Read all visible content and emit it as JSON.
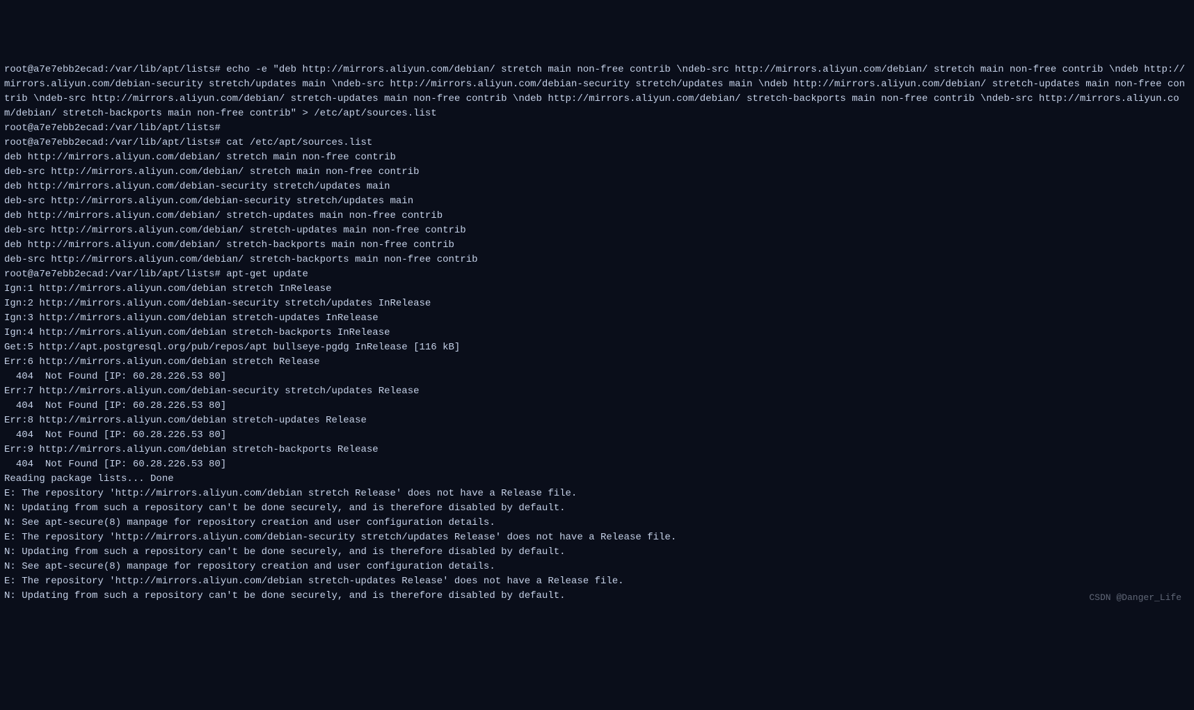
{
  "prompt": "root@a7e7ebb2ecad:/var/lib/apt/lists#",
  "lines": [
    "root@a7e7ebb2ecad:/var/lib/apt/lists# echo -e \"deb http://mirrors.aliyun.com/debian/ stretch main non-free contrib \\ndeb-src http://mirrors.aliyun.com/debian/ stretch main non-free contrib \\ndeb http://mirrors.aliyun.com/debian-security stretch/updates main \\ndeb-src http://mirrors.aliyun.com/debian-security stretch/updates main \\ndeb http://mirrors.aliyun.com/debian/ stretch-updates main non-free contrib \\ndeb-src http://mirrors.aliyun.com/debian/ stretch-updates main non-free contrib \\ndeb http://mirrors.aliyun.com/debian/ stretch-backports main non-free contrib \\ndeb-src http://mirrors.aliyun.com/debian/ stretch-backports main non-free contrib\" > /etc/apt/sources.list",
    "root@a7e7ebb2ecad:/var/lib/apt/lists#",
    "root@a7e7ebb2ecad:/var/lib/apt/lists# cat /etc/apt/sources.list",
    "deb http://mirrors.aliyun.com/debian/ stretch main non-free contrib ",
    "deb-src http://mirrors.aliyun.com/debian/ stretch main non-free contrib ",
    "deb http://mirrors.aliyun.com/debian-security stretch/updates main ",
    "deb-src http://mirrors.aliyun.com/debian-security stretch/updates main ",
    "deb http://mirrors.aliyun.com/debian/ stretch-updates main non-free contrib ",
    "deb-src http://mirrors.aliyun.com/debian/ stretch-updates main non-free contrib ",
    "deb http://mirrors.aliyun.com/debian/ stretch-backports main non-free contrib ",
    "deb-src http://mirrors.aliyun.com/debian/ stretch-backports main non-free contrib",
    "root@a7e7ebb2ecad:/var/lib/apt/lists# apt-get update",
    "Ign:1 http://mirrors.aliyun.com/debian stretch InRelease",
    "Ign:2 http://mirrors.aliyun.com/debian-security stretch/updates InRelease",
    "Ign:3 http://mirrors.aliyun.com/debian stretch-updates InRelease",
    "Ign:4 http://mirrors.aliyun.com/debian stretch-backports InRelease",
    "Get:5 http://apt.postgresql.org/pub/repos/apt bullseye-pgdg InRelease [116 kB]",
    "Err:6 http://mirrors.aliyun.com/debian stretch Release",
    "  404  Not Found [IP: 60.28.226.53 80]",
    "Err:7 http://mirrors.aliyun.com/debian-security stretch/updates Release",
    "  404  Not Found [IP: 60.28.226.53 80]",
    "Err:8 http://mirrors.aliyun.com/debian stretch-updates Release",
    "  404  Not Found [IP: 60.28.226.53 80]",
    "Err:9 http://mirrors.aliyun.com/debian stretch-backports Release",
    "  404  Not Found [IP: 60.28.226.53 80]",
    "Reading package lists... Done",
    "E: The repository 'http://mirrors.aliyun.com/debian stretch Release' does not have a Release file.",
    "N: Updating from such a repository can't be done securely, and is therefore disabled by default.",
    "N: See apt-secure(8) manpage for repository creation and user configuration details.",
    "E: The repository 'http://mirrors.aliyun.com/debian-security stretch/updates Release' does not have a Release file.",
    "N: Updating from such a repository can't be done securely, and is therefore disabled by default.",
    "N: See apt-secure(8) manpage for repository creation and user configuration details.",
    "E: The repository 'http://mirrors.aliyun.com/debian stretch-updates Release' does not have a Release file.",
    "N: Updating from such a repository can't be done securely, and is therefore disabled by default."
  ],
  "watermark": "CSDN @Danger_Life"
}
